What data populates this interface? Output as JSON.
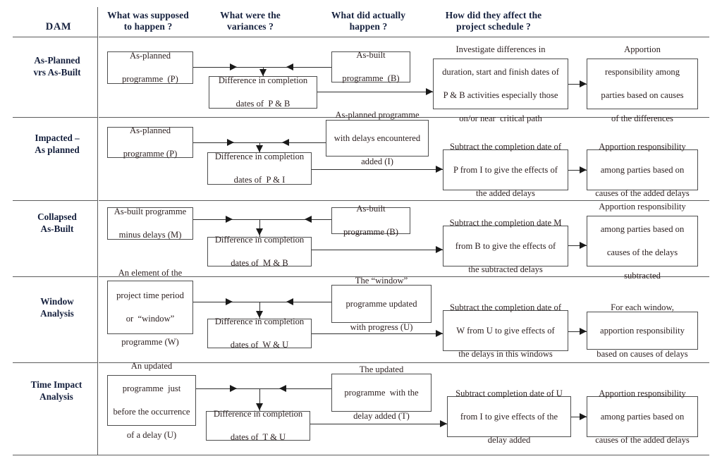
{
  "table": {
    "corner_label": "DAM",
    "column_headers": [
      "What was supposed\nto happen ?",
      "What were the\nvariances ?",
      "What did actually\nhappen ?",
      "How did they affect the\nproject schedule ?"
    ],
    "column_headers_flat": {
      "c1": "What was supposed to happen ?",
      "c2": "What were the variances ?",
      "c3": "What did actually happen ?",
      "c4": "How did they affect the project schedule ?"
    }
  },
  "rows": [
    {
      "label": "As-Planned\nvrs As-Built",
      "label_line1": "As-Planned",
      "label_line2": "vrs As-Built",
      "boxes": {
        "planned": "As-planned\nprogramme  (P)",
        "difference": "Difference in completion\ndates of  P & B",
        "actual": "As-built\nprogramme  (B)",
        "effect": "Investigate differences in\nduration, start and finish dates of\nP & B activities especially those\non/or near  critical path",
        "apportion": "Apportion\nresponsibility among\nparties based on causes\nof the differences"
      }
    },
    {
      "label": "Impacted –\nAs planned",
      "label_line1": "Impacted –",
      "label_line2": "As planned",
      "boxes": {
        "planned": "As-planned\nprogramme (P)",
        "difference": "Difference in completion\ndates of  P & I",
        "actual": "As-planned programme\nwith delays encountered\nadded (I)",
        "effect": "Subtract the completion date of\nP from I to give the effects of\nthe added delays",
        "apportion": "Apportion responsibility\namong parties based on\ncauses of the added delays"
      }
    },
    {
      "label": "Collapsed\nAs-Built",
      "label_line1": "Collapsed",
      "label_line2": "As-Built",
      "boxes": {
        "planned": "As-built programme\nminus delays (M)",
        "difference": "Difference in completion\ndates of  M & B",
        "actual": "As-built\nprogramme (B)",
        "effect": "Subtract the completion date M\nfrom B to give  the effects of\nthe subtracted delays",
        "apportion": "Apportion responsibility\namong parties based on\ncauses of the delays\nsubtracted"
      }
    },
    {
      "label": "Window\nAnalysis",
      "label_line1": "Window",
      "label_line2": "Analysis",
      "boxes": {
        "planned": "An element of the\nproject time  period\nor  “window”\nprogramme (W)",
        "difference": "Difference in completion\ndates of  W & U",
        "actual": "The “window”\nprogramme updated\nwith progress (U)",
        "effect": "Subtract the completion date of\nW from U to give  effects of\nthe delays in this windows",
        "apportion": "For each window,\napportion responsibility\nbased on causes of delays"
      }
    },
    {
      "label": "Time Impact\nAnalysis",
      "label_line1": "Time Impact",
      "label_line2": "Analysis",
      "boxes": {
        "planned": "An updated\nprogramme  just\nbefore the occurrence\nof a delay (U)",
        "difference": "Difference in completion\ndates of  T & U",
        "actual": "The updated\nprogramme  with the\ndelay added (T)",
        "effect": "Subtract completion date of U\nfrom I to give  effects of  the\ndelay added",
        "apportion": "Apportion responsibility\namong parties based on\ncauses of the added delays"
      }
    }
  ],
  "colors": {
    "rule": "#5c5c5c",
    "box_border": "#4d4d4d",
    "connector": "#2e2e2e",
    "text": "#16213e",
    "background": "#ffffff"
  }
}
